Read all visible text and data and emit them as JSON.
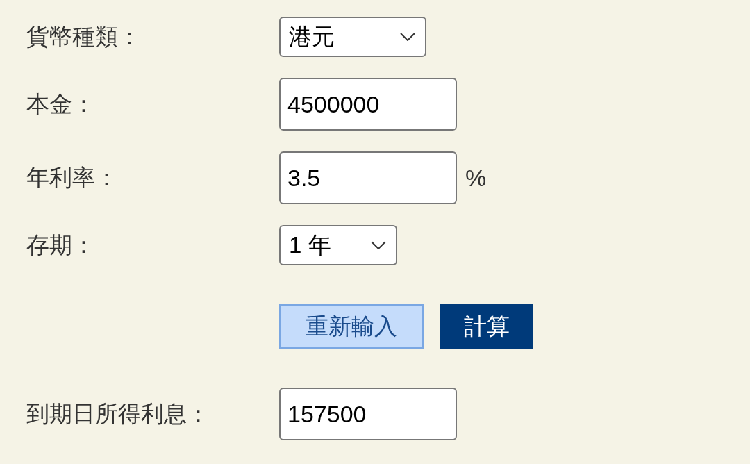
{
  "fields": [
    {
      "label": "貨幣種類：",
      "kind": "select",
      "value": "港元"
    },
    {
      "label": "本金：",
      "kind": "input",
      "value": "4500000"
    },
    {
      "label": "年利率：",
      "kind": "input",
      "value": "3.5",
      "suffix": "%"
    },
    {
      "label": "存期：",
      "kind": "select",
      "value": "1 年"
    }
  ],
  "buttons": [
    {
      "label": "重新輸入",
      "kind": "secondary"
    },
    {
      "label": "計算",
      "kind": "primary"
    }
  ],
  "result": {
    "label": "到期日所得利息：",
    "value": "157500"
  }
}
